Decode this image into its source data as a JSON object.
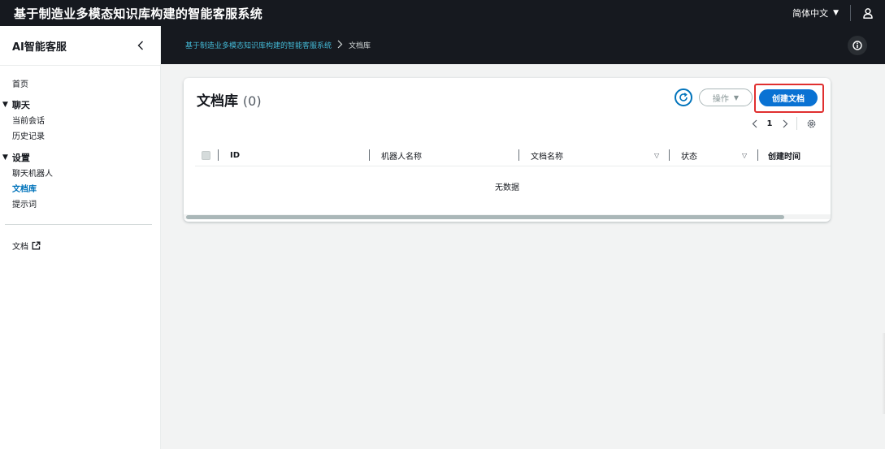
{
  "topbar": {
    "app_title": "基于制造业多模态知识库构建的智能客服系统",
    "language": "简体中文"
  },
  "sidebar": {
    "title": "AI智能客服",
    "home": "首页",
    "section_chat": "聊天",
    "chat_items": [
      "当前会话",
      "历史记录"
    ],
    "section_settings": "设置",
    "settings_items": [
      "聊天机器人",
      "文档库",
      "提示词"
    ],
    "active_item": "文档库",
    "docs_link": "文档"
  },
  "breadcrumb": {
    "root": "基于制造业多模态知识库构建的智能客服系统",
    "current": "文档库"
  },
  "panel": {
    "title": "文档库",
    "count": "(0)",
    "action_label": "操作",
    "create_label": "创建文档",
    "page_number": "1",
    "columns": [
      "ID",
      "机器人名称",
      "文档名称",
      "状态",
      "创建时间"
    ],
    "empty_text": "无数据"
  },
  "colors": {
    "header_bg": "#16191f",
    "primary": "#0972d3",
    "link": "#44b9d6",
    "highlight": "#e02f2f"
  }
}
